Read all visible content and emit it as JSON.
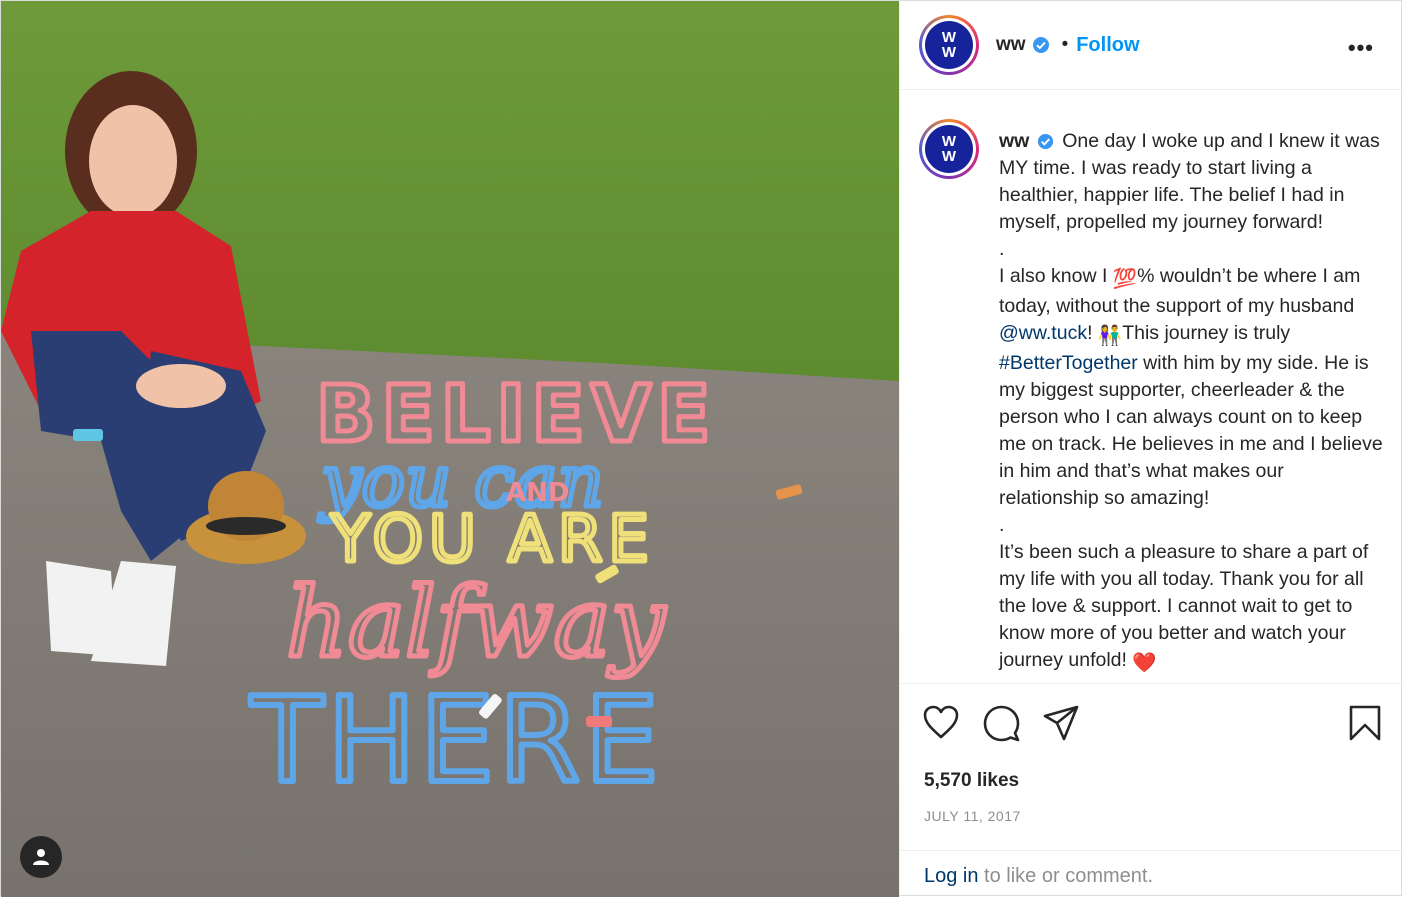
{
  "post": {
    "photo_alt": "",
    "account": {
      "username": "ww",
      "verified": true,
      "follow_label": "Follow",
      "dot": "•",
      "more_label": "•••",
      "avatar_text_top": "W",
      "avatar_text_bottom": "W"
    },
    "caption": {
      "username": "ww",
      "para1": "One day I woke up and I knew it was MY time. I was ready to start living a healthier, happier life. The belief I had in myself, propelled my journey forward!",
      "sep1": ".",
      "para2_a": "I also know I ",
      "para2_emoji": "💯",
      "para2_b": "% wouldn’t be where I am today, without the support of my husband ",
      "mention": "@ww.tuck",
      "para2_c": "! ",
      "para2_emoji2": "👫",
      "para2_d": "This journey is truly ",
      "hashtag": "#BetterTogether",
      "para2_e": " with him by my side. He is my biggest supporter, cheerleader & the person who I can always count on to keep me on track. He believes in me and I believe in him and that’s what makes our relationship so amazing!",
      "sep2": ".",
      "para3": "It’s been such a pleasure to share a part of my life with you all today. Thank you for all the love & support. I cannot wait to get to know more of you better and watch your journey unfold! ",
      "para3_emoji": "❤️"
    },
    "chalk_text": {
      "line1": "BELIEVE",
      "line2": "you can",
      "line3": "AND",
      "line4": "YOU ARE",
      "line5": "halfway",
      "line6": "THERE"
    },
    "likes": "5,570 likes",
    "date": "JULY 11, 2017",
    "login_link": "Log in",
    "login_rest": " to like or comment.",
    "colors": {
      "follow": "#0095f6",
      "link": "#00376b",
      "ww_brand": "#17239a",
      "chalk_pink": "#f08a94",
      "chalk_blue": "#5fa6e8",
      "chalk_yellow": "#efe07a"
    },
    "icons": [
      "heart-icon",
      "comment-icon",
      "share-icon",
      "bookmark-icon",
      "user-tag-icon",
      "verified-badge-icon"
    ]
  }
}
